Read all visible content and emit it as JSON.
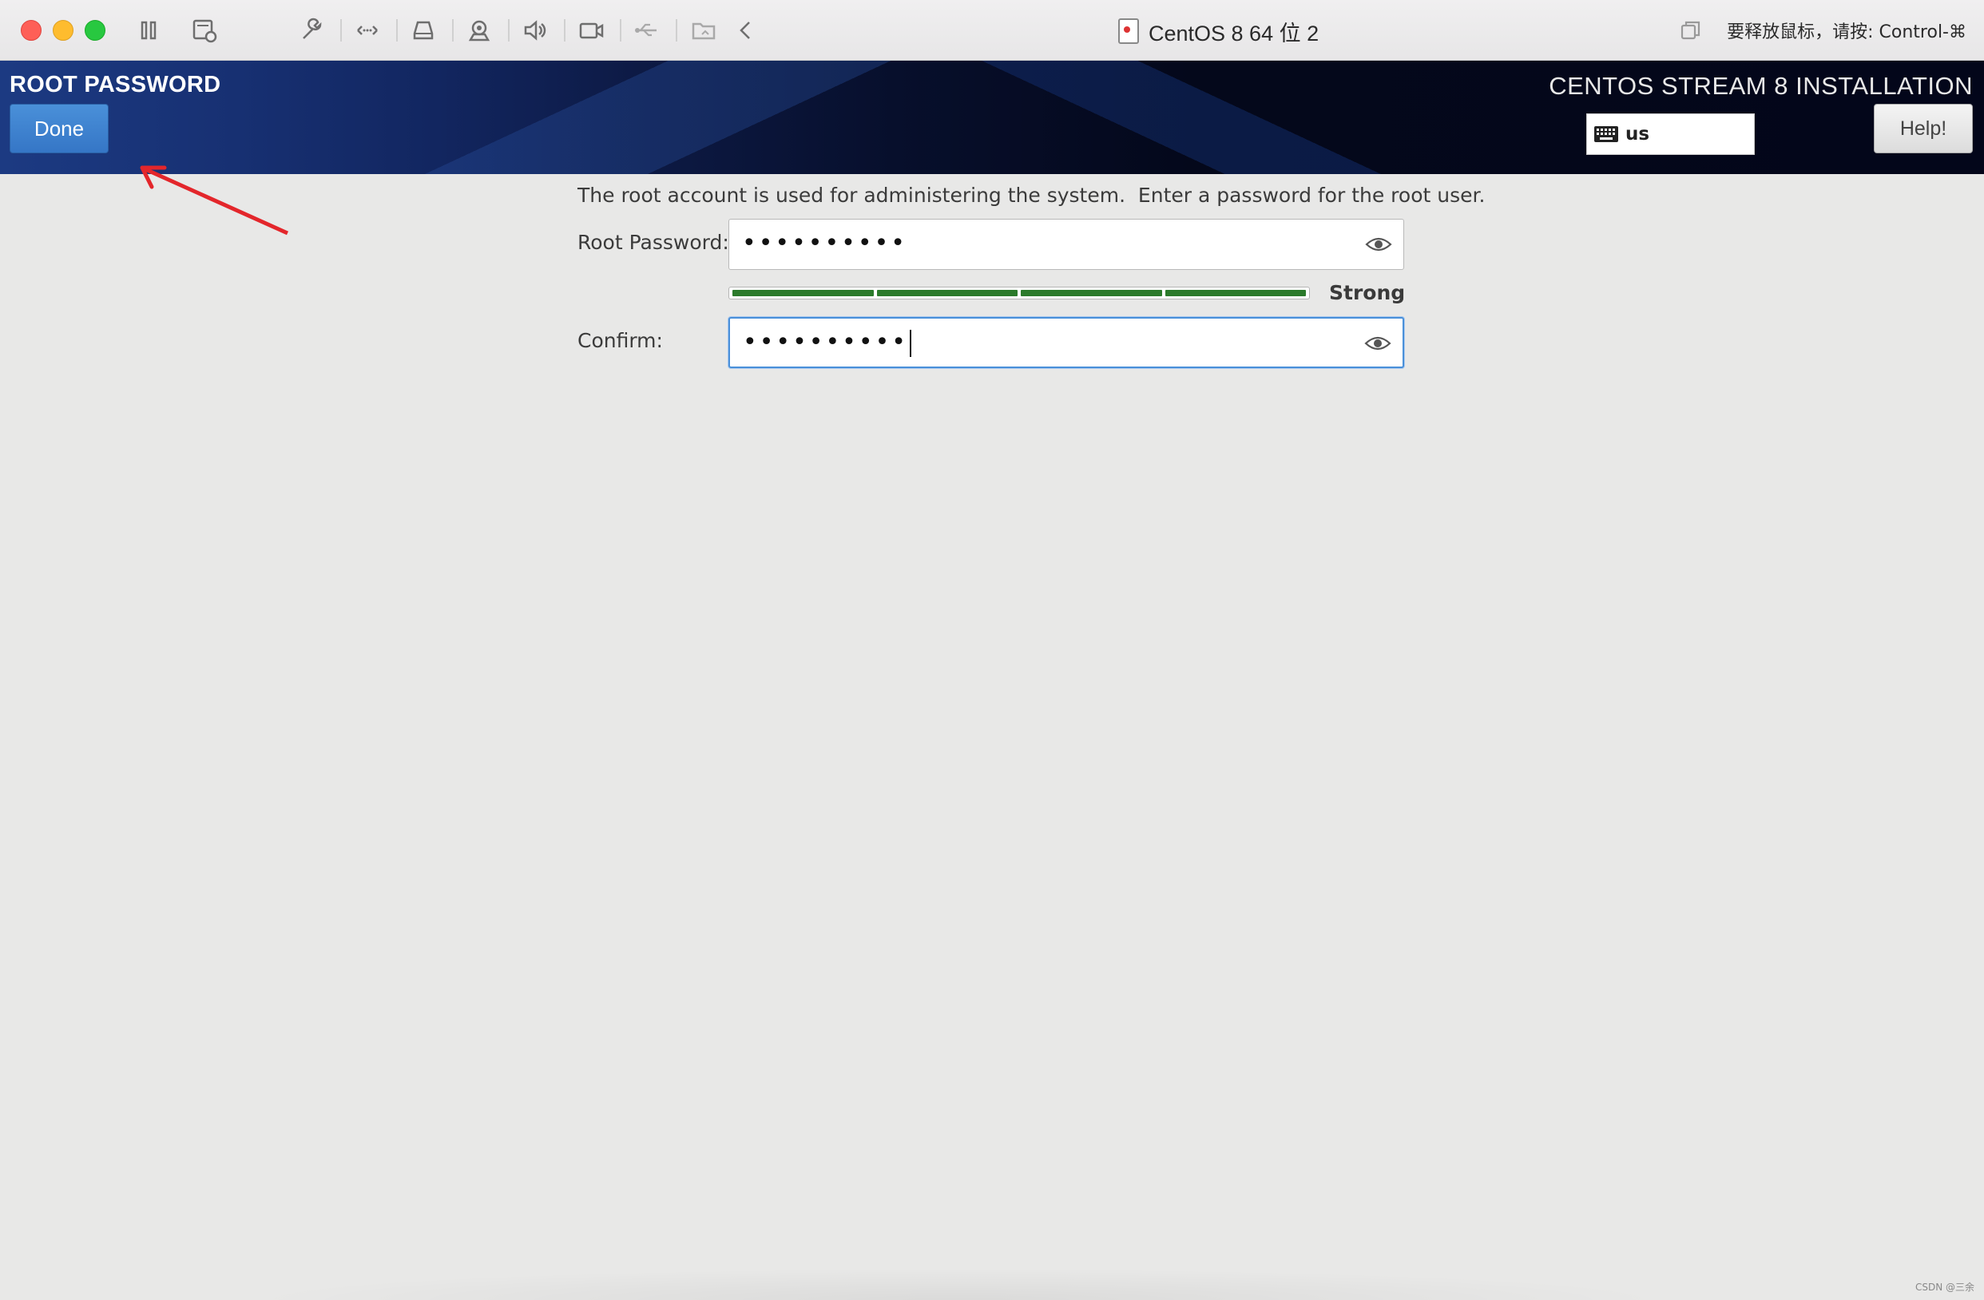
{
  "host": {
    "window_title": "CentOS 8 64 位 2",
    "release_hint": "要释放鼠标，请按: Control-⌘",
    "toolbar_icons": [
      "pause-icon",
      "snapshot-icon",
      "wrench-icon",
      "network-icon",
      "hard-disk-icon",
      "camera-icon",
      "sound-icon",
      "video-icon",
      "usb-icon",
      "shared-folder-icon",
      "chevron-left-icon"
    ]
  },
  "header": {
    "spoke_title": "ROOT PASSWORD",
    "done_label": "Done",
    "product_title": "CENTOS STREAM 8 INSTALLATION",
    "keyboard_layout": "us",
    "help_label": "Help!"
  },
  "content": {
    "intro": "The root account is used for administering the system.  Enter a password for the root user.",
    "root_password_label": "Root Password:",
    "root_password_value": "••••••••••",
    "confirm_label": "Confirm:",
    "confirm_value": "••••••••••",
    "strength_label": "Strong",
    "strength_level": 1.0,
    "strength_color": "#2b7a2b"
  },
  "watermark": "CSDN @三余"
}
